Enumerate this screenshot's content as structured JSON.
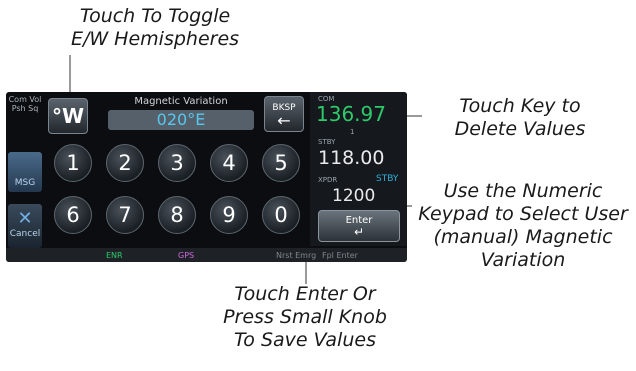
{
  "callouts": {
    "hemisphere": [
      "Touch To Toggle",
      "E/W Hemispheres"
    ],
    "backspace": [
      "Touch Key to",
      "Delete Values"
    ],
    "keypad": [
      "Use the Numeric",
      "Keypad to Select User",
      "(manual) Magnetic",
      "Variation"
    ],
    "enter": [
      "Touch Enter Or",
      "Press Small Knob",
      "To Save Values"
    ]
  },
  "screen": {
    "left_label": [
      "Com Vol",
      "Psh Sq"
    ],
    "title": "Magnetic Variation",
    "hemisphere_key": "°W",
    "value": "020°E",
    "bksp_label": "BKSP",
    "keys": [
      "1",
      "2",
      "3",
      "4",
      "5",
      "6",
      "7",
      "8",
      "9",
      "0"
    ],
    "msg_label": "MSG",
    "cancel_label": "Cancel",
    "radio": {
      "com_label": "COM",
      "com_active": "136.97",
      "com_sub": "1",
      "stby_label": "STBY",
      "com_stby": "118.00",
      "xpdr_label": "XPDR",
      "xpdr_mode": "STBY",
      "xpdr_code": "1200"
    },
    "enter_label": "Enter",
    "status": {
      "mode": "ENR",
      "source": "GPS",
      "nav": "Nrst Emrg",
      "fpl": "Fpl Enter"
    }
  }
}
